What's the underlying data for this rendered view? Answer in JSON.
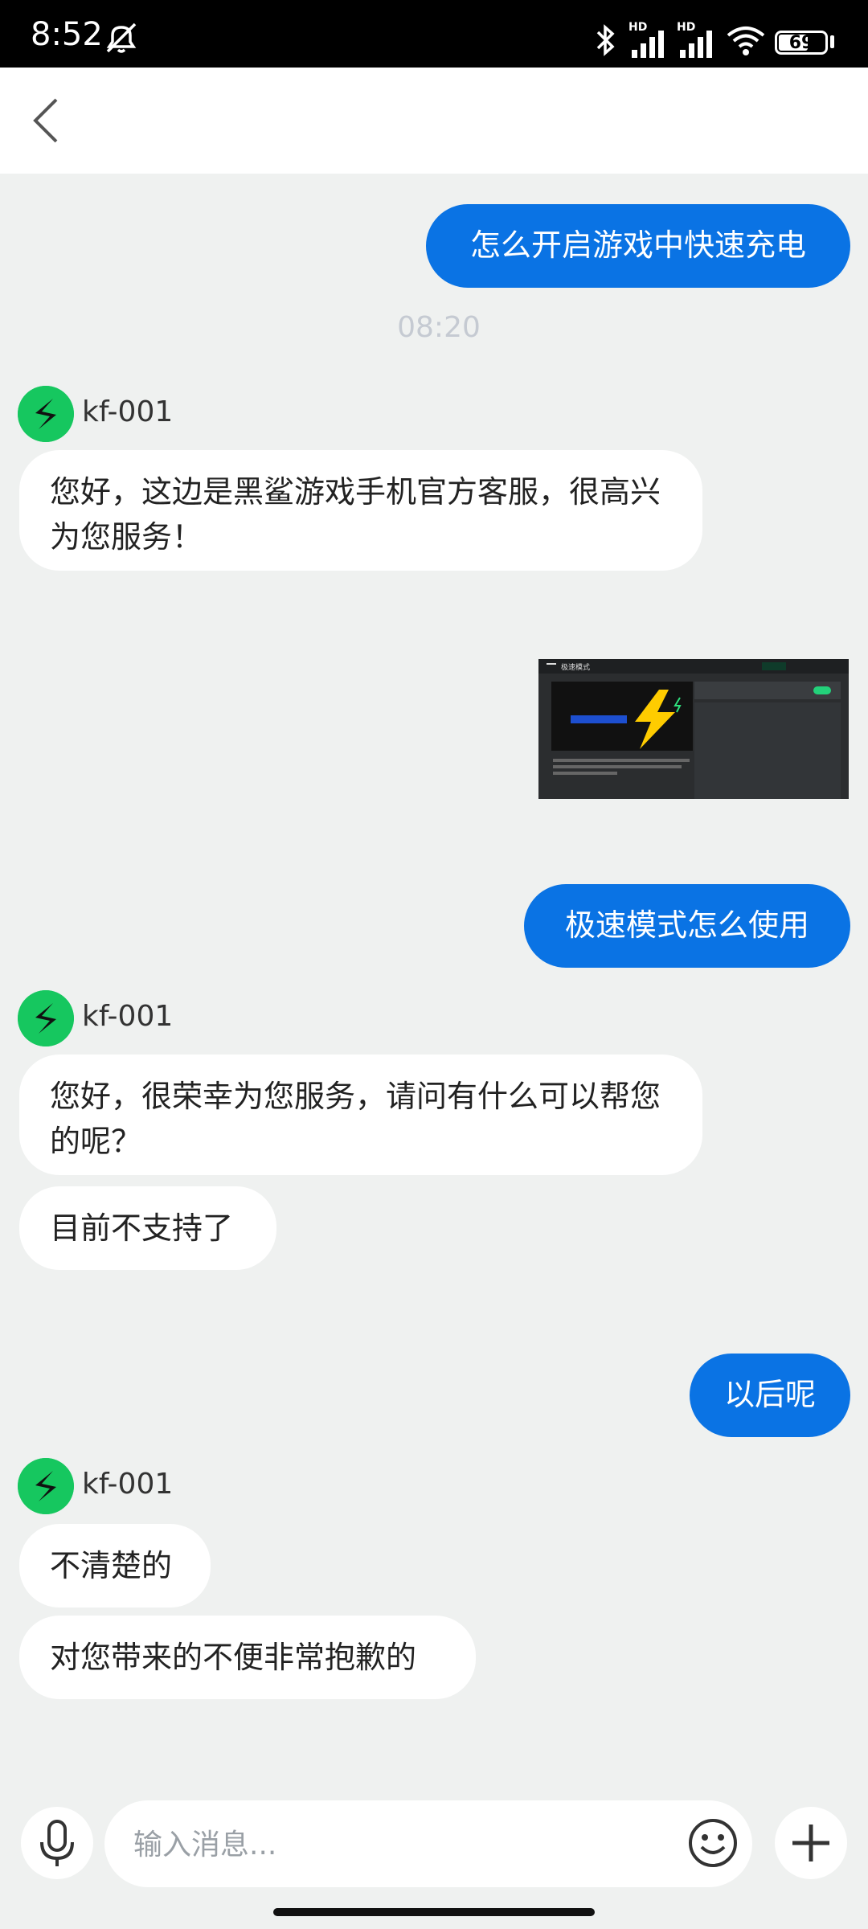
{
  "status_bar": {
    "time": "8:52",
    "battery": "69",
    "icons": [
      "mute-icon",
      "bluetooth-icon",
      "signal-icon",
      "signal-icon",
      "wifi-icon",
      "battery-icon"
    ],
    "hd_label_1": "HD",
    "hd_label_2": "HD"
  },
  "header": {
    "back_icon": "chevron-left-icon"
  },
  "chat": {
    "msg1": "怎么开启游戏中快速充电",
    "timestamp": "08:20",
    "agent_name_1": "kf-001",
    "reply1": "您好，这边是黑鲨游戏手机官方客服，很高兴为您服务！",
    "image_caption": "极速模式",
    "msg2": "极速模式怎么使用",
    "agent_name_2": "kf-001",
    "reply2": "您好，很荣幸为您服务，请问有什么可以帮您的呢？",
    "reply3": "目前不支持了",
    "msg3": "以后呢",
    "agent_name_3": "kf-001",
    "reply4": "不清楚的",
    "reply5": "对您带来的不便非常抱歉的"
  },
  "input": {
    "placeholder": "输入消息...",
    "mic_icon": "microphone-icon",
    "emoji_icon": "emoji-icon",
    "plus_icon": "plus-icon"
  },
  "colors": {
    "user_bubble": "#0a73e4",
    "avatar": "#16c75f",
    "background": "#eff1f0"
  }
}
